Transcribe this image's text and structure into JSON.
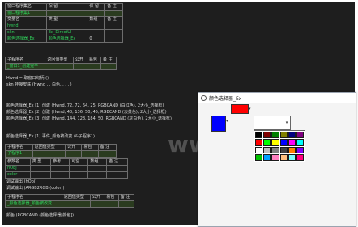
{
  "top_table": {
    "h1": [
      "窗口程序集名",
      "保 留",
      "保 留",
      "备 注"
    ],
    "h2": [
      "窗口程序集1",
      "",
      "",
      ""
    ],
    "h3": [
      "变量名",
      "类 型",
      "数组",
      "备 注"
    ],
    "r1": [
      "hwnd",
      "",
      "",
      ""
    ],
    "r2": [
      "skn",
      "Ex_DirectUI",
      "",
      ""
    ],
    "r3": [
      "颜色选择器_Ex",
      "颜色选择器_Ex",
      "0",
      ""
    ]
  },
  "sub1": {
    "header": [
      "子程序名",
      "返回值类型",
      "公开",
      "易包",
      "备 注"
    ],
    "name": "_窗口1_创建完毕"
  },
  "code_lines": [
    "Hwnd = 取窗口句柄 ()",
    "skn 挂接皮肤 (Hwnd , , 白色, , , , )",
    "",
    "颜色选择器_Ex [1] 创建 (Hwnd, 72, 72, 64, 25, RGBCAND (白红色), 2大小_选择框)",
    "颜色选择器_Ex [2] 创建 (Hwnd, 40, 136, 50, 45, RGBCAND (淡黄色), 2大小_选择框)",
    "颜色选择器_Ex [3] 创建 (Hwnd, 144, 128, 184, 50, RGBCAND (灰白色), 2大小_选择框)",
    "",
    "颜色选择器_Ex [1] 事件_颜色被改变 (&子程序1)"
  ],
  "sub2": {
    "header": [
      "子程序名",
      "返回值类型",
      "公开",
      "易包",
      "备 注"
    ],
    "name": "子程序1",
    "param_header": [
      "参数名",
      "类 型",
      "参考",
      "可空",
      "数组",
      "备 注"
    ],
    "params": [
      "hObj",
      "color"
    ]
  },
  "code2": [
    "调试输出 (hObj)",
    "调试输出 (ARGB2RGB (color))"
  ],
  "sub3": {
    "header": [
      "子程序名",
      "返回值类型",
      "公开",
      "易包",
      "备 注"
    ],
    "name": "_颜色选择器_颜色被改变",
    "call": "颜色 (RGBCAND (颜色选择器[颜色])"
  },
  "dialog": {
    "title": "颜色选择器_Ex",
    "main_color": "#ff0000",
    "small_color": "#0000ff"
  },
  "watermarks": [
    "www.qqtn.com",
    "qqtn"
  ],
  "palette_colors": [
    "#000000",
    "#7f0000",
    "#007f00",
    "#7f7f00",
    "#00007f",
    "#7f007f",
    "#ff0000",
    "#00ff00",
    "#ffff00",
    "#0000ff",
    "#ff00ff",
    "#00ffff",
    "#ffffff",
    "#c0c0c0",
    "#808080",
    "#404040",
    "#ff8000",
    "#8000ff",
    "#00c000",
    "#00a0ff",
    "#ff80c0",
    "#ffc080",
    "#80ffff",
    "#ff0080"
  ]
}
